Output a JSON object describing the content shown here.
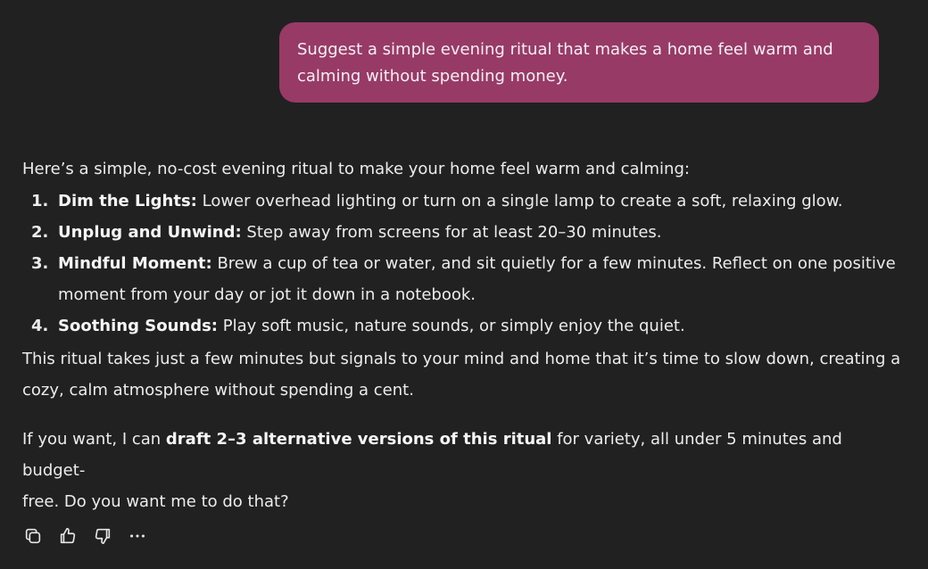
{
  "user_message": {
    "line1": "Suggest a simple evening ritual that makes a home feel warm and",
    "line2": "calming without spending money."
  },
  "assistant": {
    "intro": "Here’s a simple, no-cost evening ritual to make your home feel warm and calming:",
    "steps": [
      {
        "number": "1.",
        "title": "Dim the Lights:",
        "text": " Lower overhead lighting or turn on a single lamp to create a soft, relaxing glow."
      },
      {
        "number": "2.",
        "title": "Unplug and Unwind:",
        "text": " Step away from screens for at least 20–30 minutes."
      },
      {
        "number": "3.",
        "title": "Mindful Moment:",
        "text": " Brew a cup of tea or water, and sit quietly for a few minutes. Reflect on one positive",
        "text2": "moment from your day or jot it down in a notebook."
      },
      {
        "number": "4.",
        "title": "Soothing Sounds:",
        "text": " Play soft music, nature sounds, or simply enjoy the quiet."
      }
    ],
    "summary_line1": "This ritual takes just a few minutes but signals to your mind and home that it’s time to slow down, creating a",
    "summary_line2": "cozy, calm atmosphere without spending a cent.",
    "offer_pre": "If you want, I can ",
    "offer_bold": "draft 2–3 alternative versions of this ritual",
    "offer_post_line1": " for variety, all under 5 minutes and budget-",
    "offer_line2": "free. Do you want me to do that?"
  },
  "actions": {
    "copy_icon": "copy-icon",
    "like_icon": "thumbs-up-icon",
    "dislike_icon": "thumbs-down-icon",
    "more_icon": "more-icon"
  },
  "colors": {
    "background": "#212121",
    "user_bubble": "#983a66",
    "text": "#ececec"
  }
}
